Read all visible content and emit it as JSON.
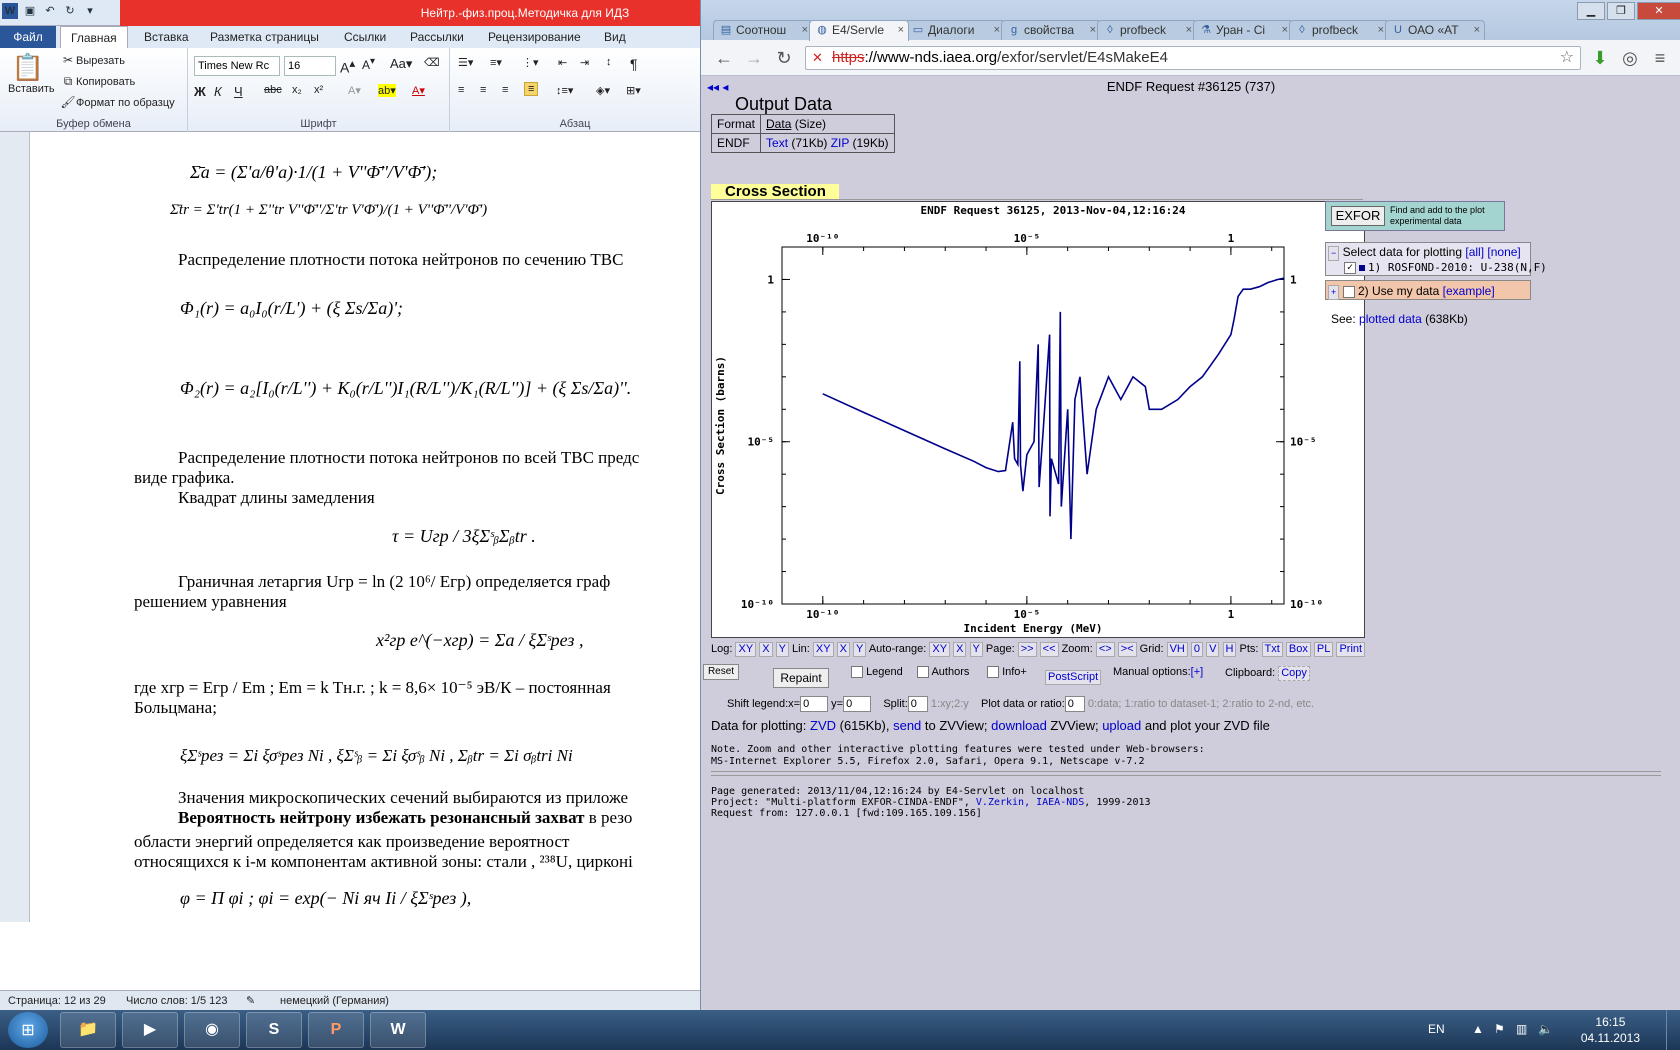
{
  "word": {
    "title": "Нейтр.-физ.проц.Методичка для ИДЗ",
    "tabs": {
      "file": "Файл",
      "home": "Главная",
      "insert": "Вставка",
      "layout": "Разметка страницы",
      "refs": "Ссылки",
      "mail": "Рассылки",
      "review": "Рецензирование",
      "view": "Вид"
    },
    "ribbon": {
      "paste": "Вставить",
      "cut": "Вырезать",
      "copy": "Копировать",
      "format_painter": "Формат по образцу",
      "clipboard_group": "Буфер обмена",
      "font_name": "Times New Rc",
      "font_size": "16",
      "font_group": "Шрифт",
      "para_group": "Абзац"
    },
    "doc": {
      "line_dist": "Распределение плотности потока нейтронов по сечению ТВС",
      "line_dist_all_1": "Распределение плотности потока нейтронов по всей ТВС предс",
      "line_dist_all_2": "виде графика.",
      "line_tau_label": "Квадрат длины замедления",
      "line_lethargy_1": "Граничная летаргия    Uгр  = ln (2 10⁶/ Eгр)  определяется граф",
      "line_lethargy_2": "решением уравнения",
      "line_where_1": "где xгр = Eгр  / Em ;  Em = k Tн.г. ;  k = 8,6× 10⁻⁵ эВ/К – постоянная",
      "line_where_2": "Больцмана;",
      "line_micro": "Значения микроскопических сечений выбираются из приложе",
      "line_prob_bold": "Вероятность нейтрону избежать резонансный захват",
      "line_prob_rest": " в резо",
      "line_prob_2": "области энергий определяется как произведение вероятност",
      "line_prob_3": "относящихся к i-м компонентам активной зоны: стали , ²³⁸U, цирконі",
      "eq_sigma_a": "Σ̄a = (Σ'a/θ'a)·1/(1 + V''Φ̄''/V'Φ̄');",
      "eq_sigma_tr": "Σ̄tr = Σ'tr(1 + Σ''tr V''Φ̄''/Σ'tr V'Φ̄')/(1 + V''Φ̄''/V'Φ̄')",
      "eq_phi1": "Φ₁(r) = a₀I₀(r/L') + (ξ Σs/Σa)';",
      "eq_phi2": "Φ₂(r) = a₂[I₀(r/L'') + K₀(r/L'')I₁(R/L'')/K₁(R/L'')] + (ξ Σs/Σa)''.",
      "eq_tau": "τ = Uгр / 3ξΣˢᵦΣᵦtr .",
      "eq_xgr": "x²гр e^(−xгр) = Σa / ξΣˢрез ,",
      "eq_sums": "ξΣˢрез = Σi ξσˢрез Ni ,  ξΣˢᵦ = Σi ξσˢᵦ Ni ,  Σᵦtr = Σi σᵦtri Ni",
      "eq_phi_prod": "φ = Π φi ;  φi = exp(− Ni яч Ii / ξΣˢрез ),"
    },
    "status": {
      "page": "Страница: 12 из 29",
      "words": "Число слов: 1/5 123",
      "lang": "немецкий (Германия)"
    }
  },
  "browser": {
    "tabs": [
      {
        "label": "Соотнош",
        "icon": "page-icon",
        "active": false
      },
      {
        "label": "E4/Servle",
        "icon": "iaea-icon",
        "active": true
      },
      {
        "label": "Диалоги",
        "icon": "forum-icon",
        "active": false
      },
      {
        "label": "свойства",
        "icon": "google-icon",
        "active": false
      },
      {
        "label": "profbeck",
        "icon": "diamond-icon",
        "active": false
      },
      {
        "label": "Уран - Сі",
        "icon": "flask-icon",
        "active": false
      },
      {
        "label": "profbeck",
        "icon": "diamond-icon",
        "active": false
      },
      {
        "label": "ОАО «АТ",
        "icon": "u-icon",
        "active": false
      }
    ],
    "url_scheme": "https",
    "url_host": "://www-nds.iaea.org",
    "url_path": "/exfor/servlet/E4sMakeE4"
  },
  "page": {
    "request_title": "ENDF Request #36125 (737)",
    "output_heading": "Output Data",
    "table": {
      "col_format": "Format",
      "col_data": "Data",
      "col_size": " (Size)",
      "row_format": "ENDF",
      "text_link": "Text",
      "text_size": " (71Kb) ",
      "zip_link": "ZIP",
      "zip_size": " (19Kb)"
    },
    "cs_title": "Cross Section",
    "exfor_button": "EXFOR",
    "exfor_desc": "Find and add to the plot experimental data",
    "select_label": "Select data for plotting ",
    "select_all": "[all]",
    "select_none": "[none]",
    "dataset1": "1) ROSFOND-2010: U-238(N,F)",
    "dataset2": "2) Use my data ",
    "dataset2_example": "[example]",
    "see_label": "See: ",
    "plotted_data_link": "plotted data",
    "plotted_data_size": " (638Kb)",
    "controls": {
      "log": "Log:",
      "lin": "Lin:",
      "autorange": "Auto-range:",
      "page": "Page:",
      "zoom": "Zoom:",
      "grid": "Grid:",
      "pts": "Pts:",
      "xy": "XY",
      "x": "X",
      "y": "Y",
      "next": ">>",
      "prev": "<<",
      "zoom_in": "<>",
      "zoom_out": "><",
      "vh": "VH",
      "zero": "0",
      "v": "V",
      "h": "H",
      "txt": "Txt",
      "box": "Box",
      "pl": "PL",
      "print": "Print",
      "reset": "Reset",
      "repaint": "Repaint",
      "legend": "Legend",
      "authors": "Authors",
      "info": "Info+",
      "postscript": "PostScript",
      "manual": "Manual options:",
      "manual_plus": "[+]",
      "clipboard": "Clipboard:",
      "copy": "Copy",
      "shift_legend": "Shift legend:x=",
      "shift_x": "0",
      "shift_y_label": "y=",
      "shift_y": "0",
      "split": "Split:",
      "split_val": "0",
      "split_hint": "1:xy;2:y",
      "ratio": "Plot data or ratio:",
      "ratio_val": "0",
      "ratio_hint": "0:data; 1:ratio to dataset-1; 2:ratio to 2-nd, etc."
    },
    "dfp_label": "Data for plotting: ",
    "dfp_zvd": "ZVD",
    "dfp_zvd_size": " (615Kb), ",
    "dfp_send": "send",
    "dfp_to": " to ZVView; ",
    "dfp_download": "download",
    "dfp_zvview": " ZVView; ",
    "dfp_upload": "upload",
    "dfp_tail": " and plot your ZVD file",
    "note_1": "Note. Zoom and other interactive plotting features were tested under Web-browsers:",
    "note_2": "MS-Internet Explorer 5.5, Firefox 2.0, Safari, Opera 9.1, Netscape v-7.2",
    "gen_1": "Page generated: 2013/11/04,12:16:24 by E4-Servlet on localhost",
    "gen_2a": "Project: \"Multi-platform EXFOR-CINDA-ENDF\", ",
    "gen_2b": "V.Zerkin, IAEA-NDS",
    "gen_2c": ", 1999-2013",
    "gen_3": "Request from: 127.0.0.1 [fwd:109.165.109.156]"
  },
  "chart_data": {
    "type": "line",
    "title": "ENDF Request 36125, 2013-Nov-04,12:16:24",
    "xlabel": "Incident Energy (MeV)",
    "ylabel": "Cross Section (barns)",
    "x_scale": "log",
    "y_scale": "log",
    "xlim": [
      1e-11,
      20
    ],
    "ylim": [
      1e-10,
      10
    ],
    "x_ticks": [
      "10⁻¹⁰",
      "10⁻⁵",
      "1"
    ],
    "y_ticks": [
      "1",
      "10⁻⁵",
      "10⁻¹⁰"
    ],
    "line_color": "#00008b",
    "series": [
      {
        "name": "1) ROSFOND-2010: U-238(N,F)",
        "x": [
          1e-10,
          1e-09,
          1e-08,
          1e-07,
          5e-07,
          1e-06,
          2e-06,
          3e-06,
          4.5e-06,
          5e-06,
          6e-06,
          6.7e-06,
          7e-06,
          8e-06,
          1e-05,
          1.5e-05,
          1.9e-05,
          2e-05,
          2.5e-05,
          3.6e-05,
          3.7e-05,
          4e-05,
          6e-05,
          6.6e-05,
          7e-05,
          0.0001,
          0.00012,
          0.00015,
          0.0002,
          0.0003,
          0.0005,
          0.001,
          0.002,
          0.004,
          0.008,
          0.01,
          0.02,
          0.05,
          0.1,
          0.2,
          0.5,
          1,
          1.2,
          1.5,
          2,
          3,
          5,
          8,
          14,
          20
        ],
        "y": [
          0.0003,
          8e-05,
          2.2e-05,
          6e-06,
          2.5e-06,
          1.6e-06,
          1.2e-06,
          1.3e-06,
          4e-05,
          3e-06,
          2e-06,
          0.003,
          2e-06,
          3e-07,
          4e-06,
          1e-05,
          0.01,
          4e-07,
          2e-05,
          0.02,
          5e-08,
          3e-06,
          5e-07,
          0.1,
          1e-07,
          0.0001,
          1e-08,
          0.0002,
          0.001,
          1e-06,
          0.0001,
          0.001,
          0.0002,
          0.001,
          0.0005,
          0.0001,
          0.0001,
          0.0002,
          0.0005,
          0.001,
          0.005,
          0.02,
          0.06,
          0.3,
          0.5,
          0.5,
          0.6,
          0.8,
          1,
          1.1
        ]
      }
    ]
  },
  "taskbar": {
    "apps": [
      "explorer-icon",
      "media-player-icon",
      "chrome-icon",
      "skype-icon",
      "powerpoint-icon",
      "word-icon"
    ],
    "lang": "EN",
    "time": "16:15",
    "date": "04.11.2013"
  }
}
